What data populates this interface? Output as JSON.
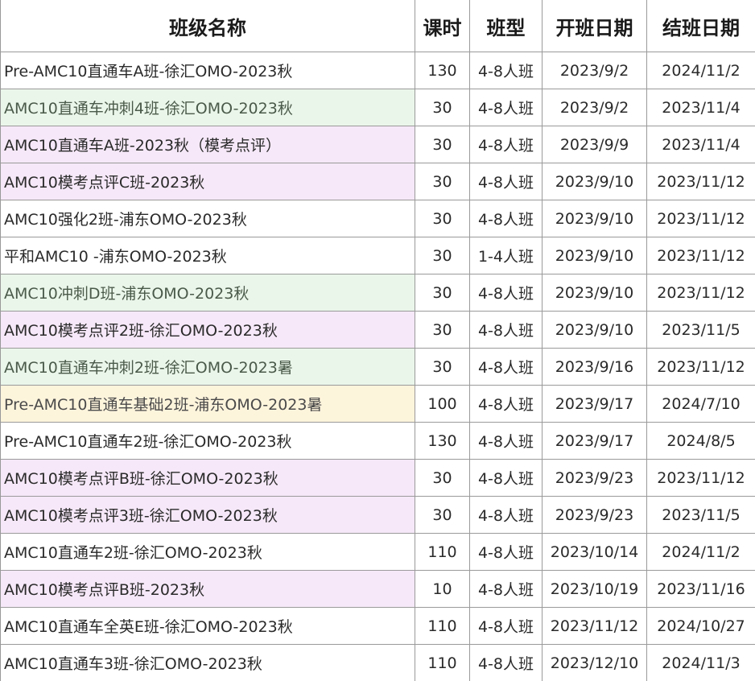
{
  "headers": [
    "班级名称",
    "课时",
    "班型",
    "开班日期",
    "结班日期"
  ],
  "rows": [
    {
      "name": "Pre-AMC10直通车A班-徐汇OMO-2023秋",
      "hours": "130",
      "type": "4-8人班",
      "start": "2023/9/2",
      "end": "2024/11/2",
      "bg": "white"
    },
    {
      "name": "AMC10直通车冲刺4班-徐汇OMO-2023秋",
      "hours": "30",
      "type": "4-8人班",
      "start": "2023/9/2",
      "end": "2023/11/4",
      "bg": "green"
    },
    {
      "name": "AMC10直通车A班-2023秋（模考点评）",
      "hours": "30",
      "type": "4-8人班",
      "start": "2023/9/9",
      "end": "2023/11/4",
      "bg": "purple"
    },
    {
      "name": "AMC10模考点评C班-2023秋",
      "hours": "30",
      "type": "4-8人班",
      "start": "2023/9/10",
      "end": "2023/11/12",
      "bg": "purple"
    },
    {
      "name": "AMC10强化2班-浦东OMO-2023秋",
      "hours": "30",
      "type": "4-8人班",
      "start": "2023/9/10",
      "end": "2023/11/12",
      "bg": "white"
    },
    {
      "name": "平和AMC10 -浦东OMO-2023秋",
      "hours": "30",
      "type": "1-4人班",
      "start": "2023/9/10",
      "end": "2023/11/12",
      "bg": "white"
    },
    {
      "name": "AMC10冲刺D班-浦东OMO-2023秋",
      "hours": "30",
      "type": "4-8人班",
      "start": "2023/9/10",
      "end": "2023/11/12",
      "bg": "green"
    },
    {
      "name": "AMC10模考点评2班-徐汇OMO-2023秋",
      "hours": "30",
      "type": "4-8人班",
      "start": "2023/9/10",
      "end": "2023/11/5",
      "bg": "purple"
    },
    {
      "name": "AMC10直通车冲刺2班-徐汇OMO-2023暑",
      "hours": "30",
      "type": "4-8人班",
      "start": "2023/9/16",
      "end": "2023/11/12",
      "bg": "green"
    },
    {
      "name": "Pre-AMC10直通车基础2班-浦东OMO-2023暑",
      "hours": "100",
      "type": "4-8人班",
      "start": "2023/9/17",
      "end": "2024/7/10",
      "bg": "yellow"
    },
    {
      "name": "Pre-AMC10直通车2班-徐汇OMO-2023秋",
      "hours": "130",
      "type": "4-8人班",
      "start": "2023/9/17",
      "end": "2024/8/5",
      "bg": "white"
    },
    {
      "name": "AMC10模考点评B班-徐汇OMO-2023秋",
      "hours": "30",
      "type": "4-8人班",
      "start": "2023/9/23",
      "end": "2023/11/12",
      "bg": "purple"
    },
    {
      "name": "AMC10模考点评3班-徐汇OMO-2023秋",
      "hours": "30",
      "type": "4-8人班",
      "start": "2023/9/23",
      "end": "2023/11/5",
      "bg": "purple"
    },
    {
      "name": "AMC10直通车2班-徐汇OMO-2023秋",
      "hours": "110",
      "type": "4-8人班",
      "start": "2023/10/14",
      "end": "2024/11/2",
      "bg": "white"
    },
    {
      "name": "AMC10模考点评B班-2023秋",
      "hours": "10",
      "type": "4-8人班",
      "start": "2023/10/19",
      "end": "2023/11/16",
      "bg": "purple"
    },
    {
      "name": "AMC10直通车全英E班-徐汇OMO-2023秋",
      "hours": "110",
      "type": "4-8人班",
      "start": "2023/11/12",
      "end": "2024/10/27",
      "bg": "white"
    },
    {
      "name": "AMC10直通车3班-徐汇OMO-2023秋",
      "hours": "110",
      "type": "4-8人班",
      "start": "2023/12/10",
      "end": "2024/11/3",
      "bg": "white"
    }
  ]
}
